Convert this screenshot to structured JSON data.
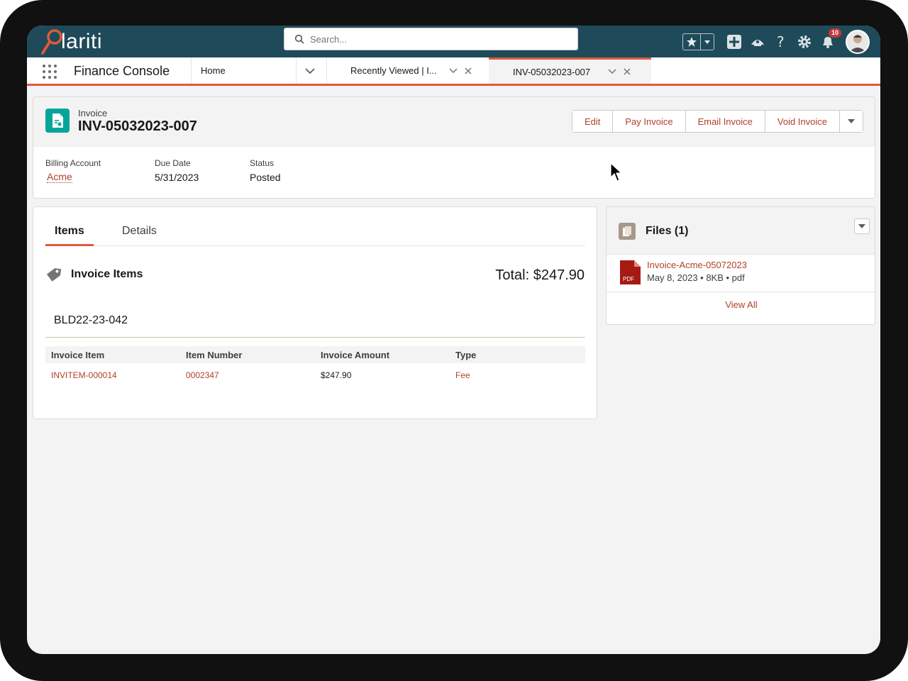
{
  "header": {
    "logo_text": "lariti",
    "search_placeholder": "Search...",
    "notification_count": "10"
  },
  "nav": {
    "app_name": "Finance Console",
    "tabs": [
      {
        "label": "Home"
      },
      {
        "label": "Recently Viewed | I..."
      },
      {
        "label": "INV-05032023-007"
      }
    ]
  },
  "record": {
    "type_label": "Invoice",
    "title": "INV-05032023-007",
    "actions": [
      "Edit",
      "Pay Invoice",
      "Email Invoice",
      "Void Invoice"
    ],
    "fields": [
      {
        "label": "Billing Account",
        "value": "Acme"
      },
      {
        "label": "Due Date",
        "value": "5/31/2023"
      },
      {
        "label": "Status",
        "value": "Posted"
      }
    ]
  },
  "items_card": {
    "tabs": [
      "Items",
      "Details"
    ],
    "section_title": "Invoice Items",
    "total": "Total: $247.90",
    "group_label": "BLD22-23-042",
    "columns": [
      "Invoice Item",
      "Item Number",
      "Invoice Amount",
      "Type"
    ],
    "rows": [
      {
        "invoice_item": "INVITEM-000014",
        "item_number": "0002347",
        "amount": "$247.90",
        "type": "Fee"
      }
    ]
  },
  "files_card": {
    "title": "Files (1)",
    "file_name": "Invoice-Acme-05072023",
    "file_meta": "May 8, 2023 • 8KB • pdf",
    "pdf_label": "PDF",
    "view_all": "View All"
  },
  "colors": {
    "header_bg": "#1f4a5a",
    "accent": "#e05a3a",
    "link": "#b0402a",
    "record_icon": "#06a59a"
  }
}
